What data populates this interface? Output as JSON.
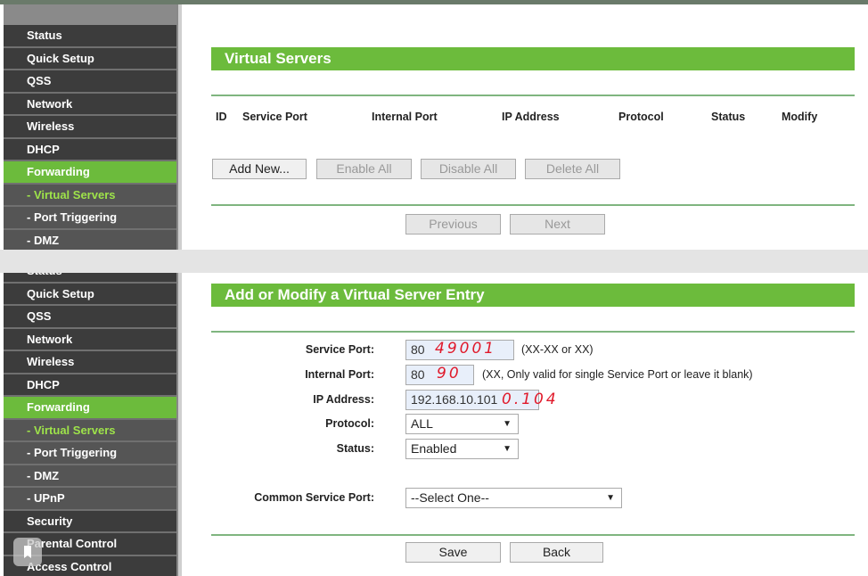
{
  "top": {
    "sidebar": [
      "Status",
      "Quick Setup",
      "QSS",
      "Network",
      "Wireless",
      "DHCP",
      "Forwarding",
      "- Virtual Servers",
      "- Port Triggering",
      "- DMZ"
    ],
    "title": "Virtual Servers",
    "columns": [
      "ID",
      "Service Port",
      "Internal Port",
      "IP Address",
      "Protocol",
      "Status",
      "Modify"
    ],
    "buttons": {
      "add": "Add New...",
      "enable": "Enable All",
      "disable": "Disable All",
      "delete": "Delete All",
      "previous": "Previous",
      "next": "Next"
    }
  },
  "bottom": {
    "sidebar": [
      "Status",
      "Quick Setup",
      "QSS",
      "Network",
      "Wireless",
      "DHCP",
      "Forwarding",
      "- Virtual Servers",
      "- Port Triggering",
      "- DMZ",
      "- UPnP",
      "Security",
      "Parental Control",
      "Access Control"
    ],
    "title": "Add or Modify a Virtual Server Entry",
    "form": {
      "service_port": {
        "label": "Service Port:",
        "value": "80",
        "hint": "(XX-XX or XX)",
        "handwritten": "49001"
      },
      "internal_port": {
        "label": "Internal Port:",
        "value": "80",
        "hint": "(XX, Only valid for single Service Port or leave it blank)",
        "handwritten": "90"
      },
      "ip_address": {
        "label": "IP Address:",
        "value": "192.168.10.101",
        "handwritten": "0.104"
      },
      "protocol": {
        "label": "Protocol:",
        "value": "ALL"
      },
      "status": {
        "label": "Status:",
        "value": "Enabled"
      },
      "common_service_port": {
        "label": "Common Service Port:",
        "value": "--Select One--"
      }
    },
    "buttons": {
      "save": "Save",
      "back": "Back"
    }
  },
  "colors": {
    "accent": "#6cbb3c",
    "sidebar": "#3c3c3c",
    "annotation": "#e0192a"
  }
}
